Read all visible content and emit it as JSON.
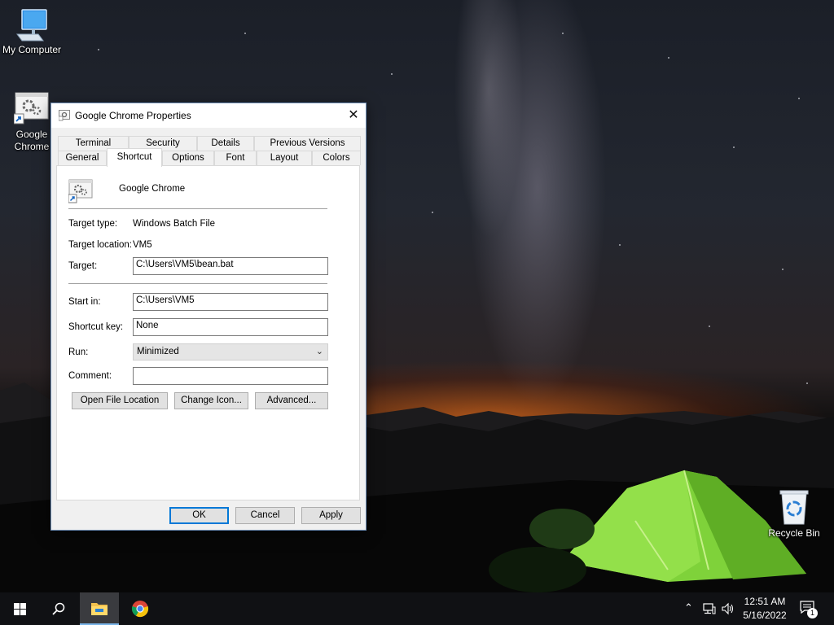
{
  "desktop": {
    "icons": [
      {
        "label": "My Computer"
      },
      {
        "label": "Google\nChrome"
      },
      {
        "label": "Recycle Bin"
      }
    ]
  },
  "dialog": {
    "title": "Google Chrome Properties",
    "close_glyph": "✕",
    "tabs_row1": [
      "Terminal",
      "Security",
      "Details",
      "Previous Versions"
    ],
    "tabs_row2": [
      "General",
      "Shortcut",
      "Options",
      "Font",
      "Layout",
      "Colors"
    ],
    "active_tab": "Shortcut",
    "shortcut_name": "Google Chrome",
    "target_type_label": "Target type:",
    "target_type_value": "Windows Batch File",
    "target_location_label": "Target location:",
    "target_location_value": "VM5",
    "target_label": "Target:",
    "target_value": "C:\\Users\\VM5\\bean.bat",
    "start_in_label": "Start in:",
    "start_in_value": "C:\\Users\\VM5",
    "shortcut_key_label": "Shortcut key:",
    "shortcut_key_value": "None",
    "run_label": "Run:",
    "run_value": "Minimized",
    "comment_label": "Comment:",
    "comment_value": "",
    "buttons": {
      "open_file_location": "Open File Location",
      "change_icon": "Change Icon...",
      "advanced": "Advanced...",
      "ok": "OK",
      "cancel": "Cancel",
      "apply": "Apply"
    }
  },
  "taskbar": {
    "icons": [
      "windows-start-icon",
      "search-icon",
      "file-explorer-icon",
      "chrome-icon"
    ],
    "tray_icons": [
      "chevron-up-icon",
      "network-icon",
      "volume-icon"
    ],
    "time": "12:51 AM",
    "date": "5/16/2022",
    "notification_count": "1"
  },
  "colors": {
    "accent": "#0078d7",
    "taskbar": "#101114",
    "dialog_bg": "#f0f0f0"
  }
}
